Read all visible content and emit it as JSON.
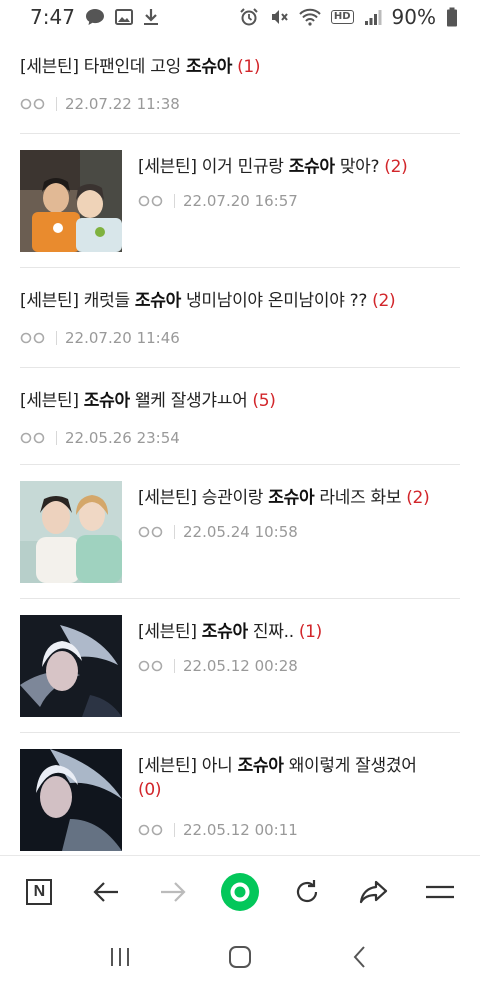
{
  "status": {
    "time": "7:47",
    "battery": "90%",
    "hd": "HD"
  },
  "posts": [
    {
      "prefix": "[세븐틴] 타팬인데 고잉 ",
      "keyword": "조슈아",
      "suffix": "",
      "count": "(1)",
      "date": "22.07.22 11:38"
    },
    {
      "prefix": "[세븐틴] 이거 민규랑 ",
      "keyword": "조슈아",
      "suffix": " 맞아?",
      "count": "(2)",
      "date": "22.07.20 16:57"
    },
    {
      "prefix": "[세븐틴] 캐럿들 ",
      "keyword": "조슈아",
      "suffix": " 냉미남이야 온미남이야 ??",
      "count": "(2)",
      "date": "22.07.20 11:46"
    },
    {
      "prefix": "[세븐틴] ",
      "keyword": "조슈아",
      "suffix": " 왤케 잘생갸ㅛ어",
      "count": "(5)",
      "date": "22.05.26 23:54"
    },
    {
      "prefix": "[세븐틴] 승관이랑 ",
      "keyword": "조슈아",
      "suffix": " 라네즈 화보",
      "count": "(2)",
      "date": "22.05.24 10:58"
    },
    {
      "prefix": "[세븐틴] ",
      "keyword": "조슈아",
      "suffix": " 진짜..",
      "count": "(1)",
      "date": "22.05.12 00:28"
    },
    {
      "prefix": "[세븐틴] 아니 ",
      "keyword": "조슈아",
      "suffix": " 왜이렇게 잘생겼어",
      "count": "(0)",
      "date": "22.05.12 00:11"
    }
  ],
  "toolbar": {
    "home_label": "N"
  },
  "colors": {
    "accent_green": "#03c75a",
    "count_red": "#d2262b"
  }
}
